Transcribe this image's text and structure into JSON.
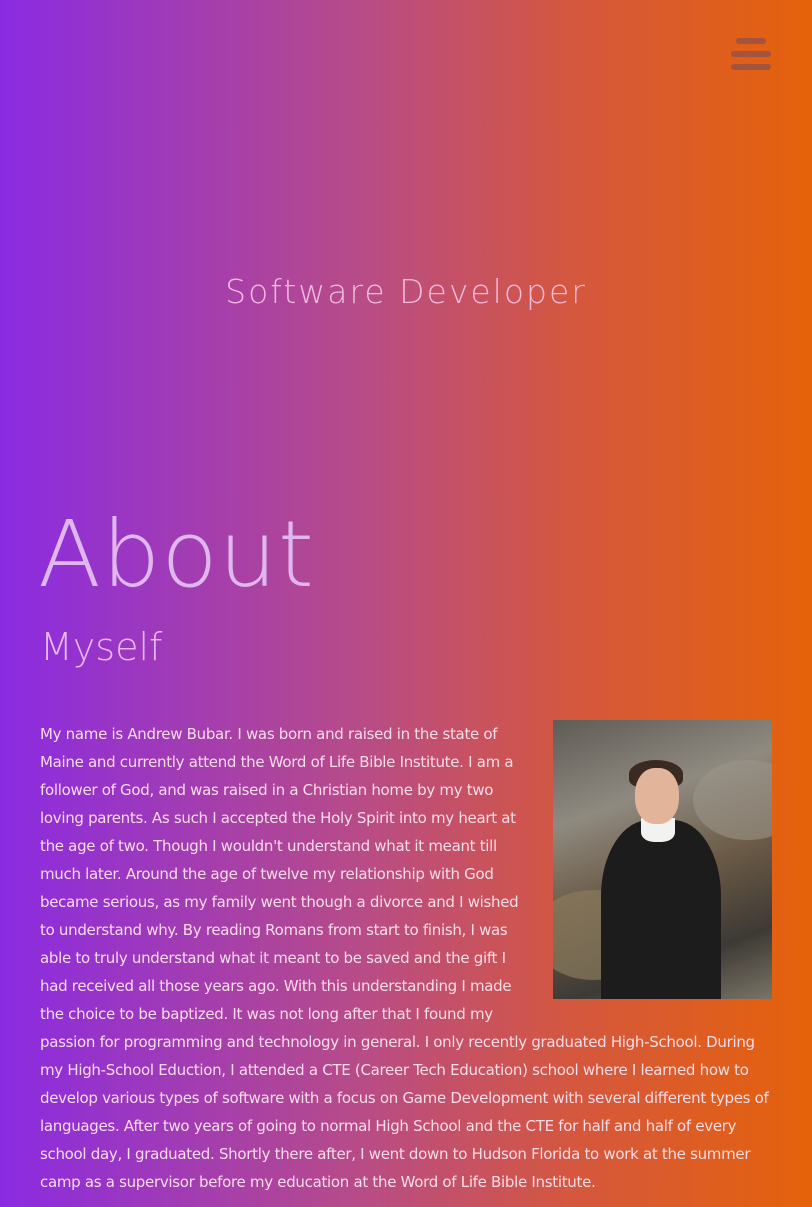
{
  "nav": {
    "menu_icon": "hamburger-menu-icon"
  },
  "hero": {
    "title": "Software Developer"
  },
  "about": {
    "heading": "About",
    "subheading": "Myself",
    "photo_icon": "portrait-photo",
    "text": "My name is Andrew Bubar. I was born and raised in the state of Maine and currently attend the Word of Life Bible Institute. I am a follower of God, and was raised in a Christian home by my two loving parents. As such I accepted the Holy Spirit into my heart at the age of two. Though I wouldn't understand what it meant till much later. Around the age of twelve my relationship with God became serious, as my family went though a divorce and I wished to understand why. By reading Romans from start to finish, I was able to truly understand what it meant to be saved and the gift I had received all those years ago. With this understanding I made the choice to be baptized. It was not long after that I found my passion for programming and technology in general. I only recently graduated High-School. During my High-School Eduction, I attended a CTE (Career Tech Education) school where I learned how to develop various types of software with a focus on Game Development with several different types of languages. After two years of going to normal High School and the CTE for half and half of every school day, I graduated. Shortly there after, I went down to Hudson Florida to work at the summer camp as a supervisor before my education at the Word of Life Bible Institute."
  },
  "colors": {
    "gradient_start": "#8a2be2",
    "gradient_end": "#e5620a",
    "heading_color": "#e0b6ee",
    "text_color": "#f8dce8"
  }
}
